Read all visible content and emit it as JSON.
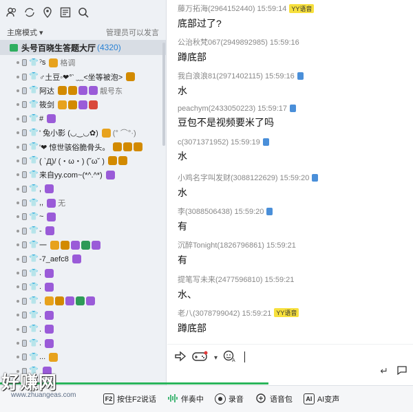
{
  "left": {
    "mode_label": "主席模式 ▾",
    "admin_note": "管理员可以发言",
    "channel_name": "头号百晓生答题大厅",
    "channel_count": "(4320)",
    "users": [
      {
        "name": "ˀs",
        "suffix": "格调",
        "badges": [
          "crown"
        ]
      },
      {
        "name": "♂土豆◦❤°‵ ﹏<坐等被泡>",
        "badges": [
          "gold"
        ]
      },
      {
        "name": "阿达",
        "suffix": "靓号东",
        "badges": [
          "gold",
          "gold",
          "purple",
          "purple"
        ]
      },
      {
        "name": "筱剑",
        "badges": [
          "crown",
          "gold",
          "purple",
          "red"
        ]
      },
      {
        "name": "#",
        "badges": [
          "purple"
        ]
      },
      {
        "name": "' 兔小影 (◡‿◡✿)",
        "badges": [
          "crown"
        ],
        "suffix": "(° ⌒°·)"
      },
      {
        "name": "'❤ 惊世骇俗脆骨头。",
        "badges": [
          "gold",
          "gold",
          "gold"
        ]
      },
      {
        "name": "( `Д)/ (・ω・) (˘ω˘ )",
        "badges": [
          "gold",
          "gold"
        ]
      },
      {
        "name": "来自yy.com~(*^.^*)",
        "badges": [
          "purple"
        ]
      },
      {
        "name": ",",
        "badges": [
          "purple"
        ]
      },
      {
        "name": ",,",
        "badges": [
          "purple"
        ],
        "suffix": "无"
      },
      {
        "name": "~",
        "badges": [
          "purple"
        ]
      },
      {
        "name": "-",
        "badges": [
          "purple"
        ]
      },
      {
        "name": "一",
        "badges": [
          "crown",
          "gold",
          "purple",
          "green",
          "purple"
        ]
      },
      {
        "name": "-7_aefc8",
        "badges": [
          "purple"
        ]
      },
      {
        "name": ".",
        "badges": [
          "purple"
        ]
      },
      {
        "name": ".",
        "badges": [
          "purple"
        ]
      },
      {
        "name": ".",
        "badges": [
          "crown",
          "gold",
          "purple",
          "green",
          "purple"
        ]
      },
      {
        "name": ".",
        "badges": [
          "purple"
        ]
      },
      {
        "name": ".",
        "badges": [
          "purple"
        ]
      },
      {
        "name": ".",
        "badges": [
          "purple"
        ]
      },
      {
        "name": "...",
        "badges": [
          "crown"
        ]
      },
      {
        "name": "",
        "badges": [
          "purple"
        ]
      }
    ]
  },
  "chat": [
    {
      "meta": "藤万拓海(2964152440)  15:59:14",
      "tag": "YY语音",
      "text": "底部过了?"
    },
    {
      "meta": "公治秋梵067(2949892985)  15:59:16",
      "text": "蹲底部"
    },
    {
      "meta": "我白浪浪81(2971402115)  15:59:16",
      "card": true,
      "text": "水"
    },
    {
      "meta": "peachym(2433050223)  15:59:17",
      "card": true,
      "text": "豆包不是视频要米了吗"
    },
    {
      "meta": "c(3071371952)  15:59:19",
      "card": true,
      "text": "水"
    },
    {
      "meta": "小鸡名字叫发财(3088122629)  15:59:20",
      "card": true,
      "text": "水"
    },
    {
      "meta": "李(3088506438)  15:59:20",
      "card": true,
      "text": "有"
    },
    {
      "meta": "沉醉Tonight(1826796861)  15:59:21",
      "text": "有"
    },
    {
      "meta": "提笔写未来(2477596810)  15:59:21",
      "text": "水、"
    },
    {
      "meta": "老八(3078799042)  15:59:21",
      "tag": "YY语音",
      "text": "蹲底部"
    }
  ],
  "bottom": {
    "f2": "按住F2说话",
    "accompany": "伴奏中",
    "record": "录音",
    "voicepack": "语音包",
    "ai": "AI变声"
  },
  "watermark": {
    "big": "好赚网",
    "small": "www.zhuangeas.com"
  },
  "colors": {
    "accent": "#2a82d4",
    "green": "#2ab55b",
    "yy_tag": "#f7e03d"
  }
}
